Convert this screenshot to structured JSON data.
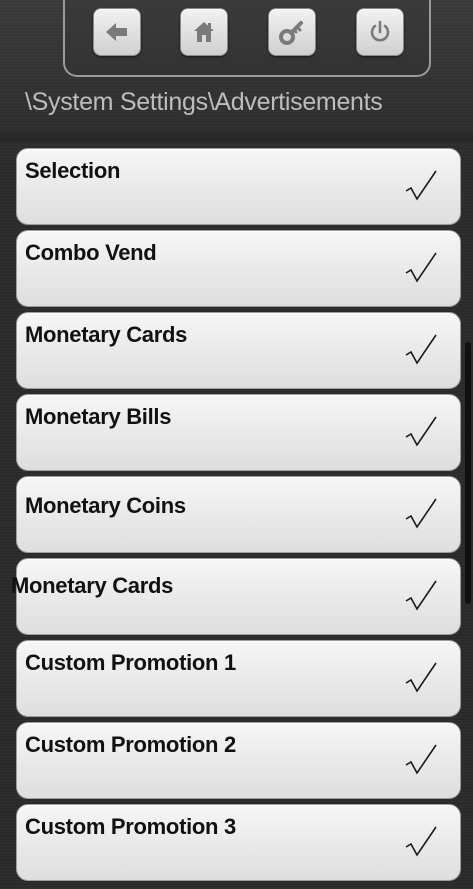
{
  "header": {
    "breadcrumb": "\\System Settings\\Advertisements",
    "nav": [
      {
        "icon": "back-arrow-icon"
      },
      {
        "icon": "home-icon"
      },
      {
        "icon": "key-icon"
      },
      {
        "icon": "power-icon"
      }
    ]
  },
  "items": [
    {
      "label": "Selection",
      "checked": true
    },
    {
      "label": "Combo Vend",
      "checked": true
    },
    {
      "label": "Monetary Cards",
      "checked": true
    },
    {
      "label": "Monetary Bills",
      "checked": true
    },
    {
      "label": "Monetary Coins",
      "checked": true
    },
    {
      "label": "Monetary Cards",
      "checked": true
    },
    {
      "label": "Custom Promotion 1",
      "checked": true
    },
    {
      "label": "Custom Promotion 2",
      "checked": true
    },
    {
      "label": "Custom Promotion 3",
      "checked": true
    }
  ]
}
